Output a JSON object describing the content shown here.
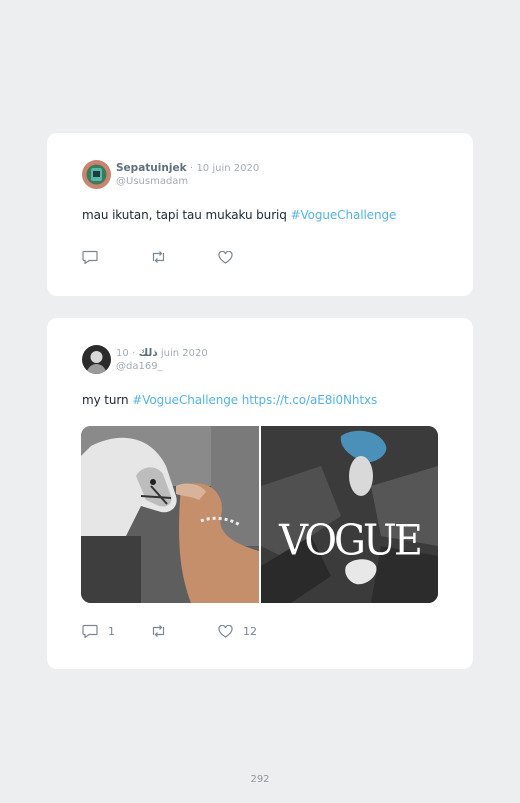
{
  "tweets": [
    {
      "name": "Sepatuinjek",
      "separator": "·",
      "date": "10 juin 2020",
      "handle": "@Ususmadam",
      "text": "mau ikutan, tapi tau mukaku buriq ",
      "hashtag": "#VogueChallenge",
      "url": "",
      "reply_count": "",
      "retweet_count": "",
      "like_count": ""
    },
    {
      "name": "ذلك",
      "separator": "·",
      "date": "10 juin 2020",
      "handle": "@da169_",
      "text": "my turn ",
      "hashtag": "#VogueChallenge",
      "url": " https://t.co/aE8i0Nhtxs",
      "media_overlay_text": "VOGUE",
      "reply_count": "1",
      "retweet_count": "",
      "like_count": "12"
    }
  ],
  "icons": {
    "reply": "reply-icon",
    "retweet": "retweet-icon",
    "like": "heart-icon"
  },
  "colors": {
    "background": "#eceef0",
    "card": "#ffffff",
    "link": "#55b3e5",
    "muted": "#a3acb5"
  },
  "page_number": "292"
}
